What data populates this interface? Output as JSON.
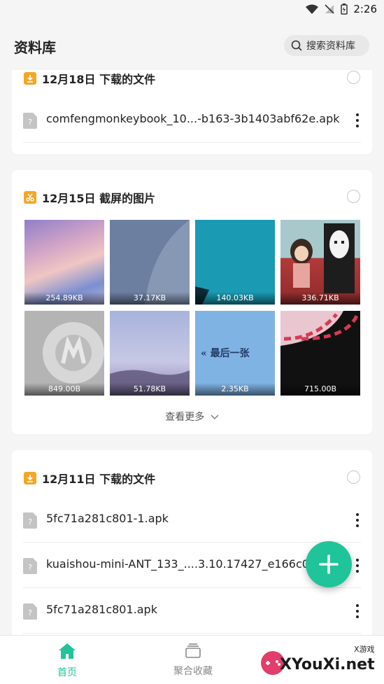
{
  "status": {
    "time": "2:26"
  },
  "header": {
    "title": "资料库",
    "search_label": "搜索资料库"
  },
  "sections": [
    {
      "date_title": "12月18日 下载的文件",
      "type": "download",
      "files": [
        {
          "name": "comfengmonkeybook_10...-b163-3b1403abf62e.apk"
        }
      ]
    },
    {
      "date_title": "12月15日 截屏的图片",
      "type": "screenshot",
      "images": [
        {
          "size": "254.89KB"
        },
        {
          "size": "37.17KB"
        },
        {
          "size": "140.03KB"
        },
        {
          "size": "336.71KB"
        },
        {
          "size": "849.00B"
        },
        {
          "size": "51.78KB"
        },
        {
          "size": "2.35KB",
          "caption": "« 最后一张"
        },
        {
          "size": "715.00B"
        }
      ],
      "more_label": "查看更多"
    },
    {
      "date_title": "12月11日 下载的文件",
      "type": "download",
      "files": [
        {
          "name": "5fc71a281c801-1.apk"
        },
        {
          "name": "kuaishou-mini-ANT_133_....3.10.17427_e166c0."
        },
        {
          "name": "5fc71a281c801.apk"
        }
      ]
    }
  ],
  "tabs": [
    {
      "label": "首页",
      "active": true
    },
    {
      "label": "聚合收藏",
      "active": false
    }
  ],
  "watermark": {
    "text": "XYouXi.net",
    "small": "X游戏"
  },
  "colors": {
    "accent": "#1fc49a",
    "download_badge": "#f5a623",
    "screenshot_badge": "#f5a623"
  }
}
